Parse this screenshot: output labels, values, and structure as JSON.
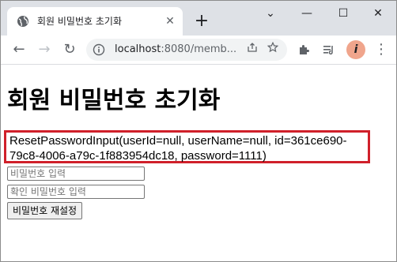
{
  "browser": {
    "tab": {
      "title": "회원 비밀번호 초기화",
      "close_glyph": "✕"
    },
    "new_tab_glyph": "+",
    "window_controls": {
      "menu_glyph": "⌄",
      "minimize_glyph": "—",
      "maximize_glyph": "☐",
      "close_glyph": "✕"
    },
    "toolbar": {
      "back_glyph": "←",
      "forward_glyph": "→",
      "reload_glyph": "↻",
      "url_host": "localhost",
      "url_rest": ":8080/memb...",
      "extensions_glyph": "✚",
      "menu_glyph": "⋮",
      "avatar_letter": "i"
    }
  },
  "page": {
    "heading": "회원 비밀번호 초기화",
    "info_line1": "ResetPasswordInput(userId=null, userName=null, id=361ce690-",
    "info_line2": "79c8-4006-a79c-1f883954dc18, password=1111)",
    "password_placeholder": "비밀번호 입력",
    "confirm_placeholder": "확인 비밀번호 입력",
    "submit_label": "비밀번호 재설정"
  },
  "colors": {
    "highlight_border": "#d0202a",
    "tabstrip_bg": "#dee1e6",
    "omnibox_bg": "#f1f3f4"
  }
}
